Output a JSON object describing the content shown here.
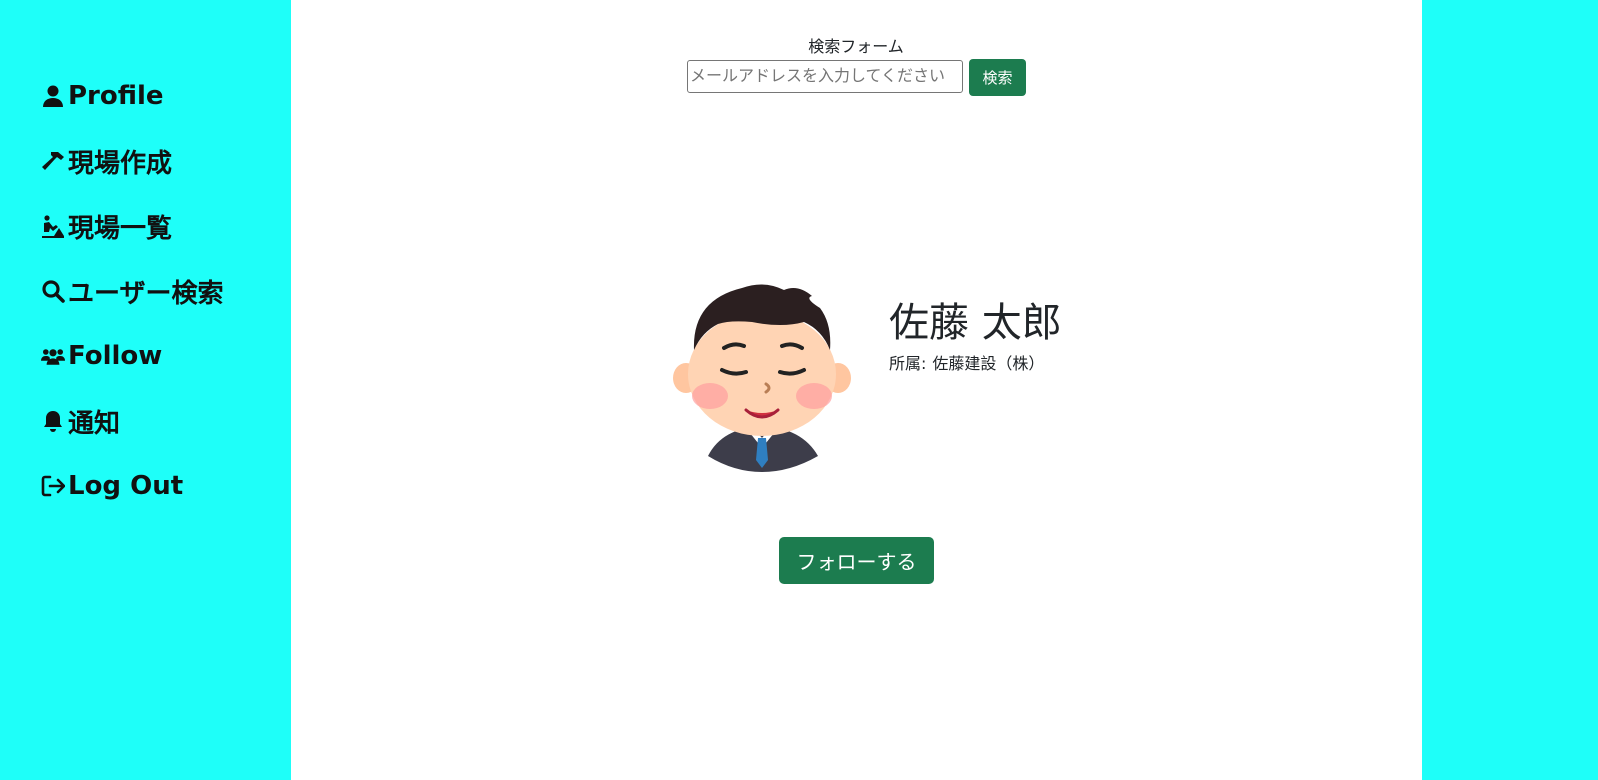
{
  "colors": {
    "sidebar_bg": "#1efff9",
    "main_bg": "#ffffff",
    "button_bg": "#1c7c4f",
    "button_text": "#ffffff",
    "nav_text": "#111111"
  },
  "sidebar": {
    "items": [
      {
        "icon": "user-icon",
        "label": "Profile"
      },
      {
        "icon": "hammer-icon",
        "label": "現場作成"
      },
      {
        "icon": "person-digging-icon",
        "label": "現場一覧"
      },
      {
        "icon": "search-icon",
        "label": "ユーザー検索"
      },
      {
        "icon": "users-icon",
        "label": "Follow"
      },
      {
        "icon": "bell-icon",
        "label": "通知"
      },
      {
        "icon": "logout-icon",
        "label": "Log Out"
      }
    ]
  },
  "search": {
    "label": "検索フォーム",
    "placeholder": "メールアドレスを入力してください",
    "value": "",
    "button_label": "検索"
  },
  "profile": {
    "avatar_icon": "businessman-avatar",
    "name": "佐藤 太郎",
    "affiliation_label": "所属:",
    "affiliation_value": "佐藤建設（株）"
  },
  "actions": {
    "follow_label": "フォローする"
  }
}
